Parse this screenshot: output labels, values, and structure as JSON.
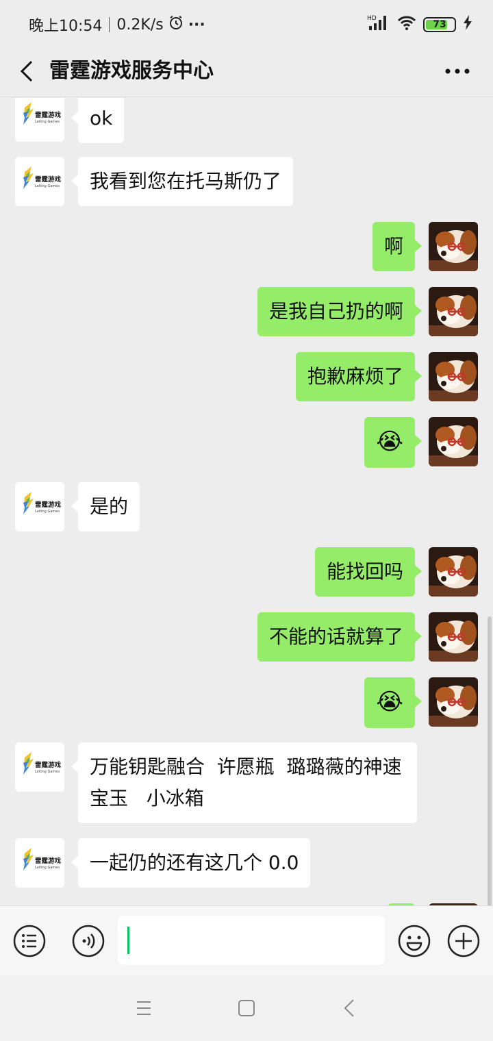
{
  "status_bar": {
    "time": "晚上10:54",
    "net_speed": "0.2K/s",
    "alarm_icon": "alarm-clock-icon",
    "more_dots": "···",
    "hd_label": "HD",
    "battery": "73"
  },
  "header": {
    "title": "雷霆游戏服务中心",
    "back_icon": "chevron-left-icon",
    "more_icon": "more-dots-icon",
    "more_text": "···"
  },
  "logo": {
    "name": "雷霆游戏",
    "sub": "Leiting Games"
  },
  "messages": [
    {
      "side": "left",
      "text": "ok"
    },
    {
      "side": "left",
      "text": "我看到您在托马斯仍了"
    },
    {
      "side": "right",
      "text": "啊"
    },
    {
      "side": "right",
      "text": "是我自己扔的啊"
    },
    {
      "side": "right",
      "text": "抱歉麻烦了"
    },
    {
      "side": "right",
      "emoji": "😭",
      "emoji_name": "crying-laughing-emoji"
    },
    {
      "side": "left",
      "text": "是的"
    },
    {
      "side": "right",
      "text": "能找回吗"
    },
    {
      "side": "right",
      "text": "不能的话就算了"
    },
    {
      "side": "right",
      "emoji": "😭",
      "emoji_name": "crying-laughing-emoji"
    },
    {
      "side": "left",
      "text": "万能钥匙融合  许愿瓶  璐璐薇的神速宝玉   小冰箱"
    },
    {
      "side": "left",
      "text": "一起仍的还有这几个 0.0"
    }
  ],
  "input_bar": {
    "menu_icon": "menu-list-icon",
    "voice_icon": "voice-icon",
    "emoji_icon": "emoji-smile-icon",
    "plus_icon": "plus-icon",
    "input_value": "",
    "input_placeholder": ""
  },
  "nav_bar": {
    "menu_icon": "nav-menu-icon",
    "home_icon": "nav-home-icon",
    "back_icon": "nav-back-icon"
  },
  "colors": {
    "bg": "#ededed",
    "bubble_me": "#95ec69",
    "bubble_other": "#ffffff",
    "caret": "#07c160",
    "battery_fill": "#6dd34a"
  }
}
